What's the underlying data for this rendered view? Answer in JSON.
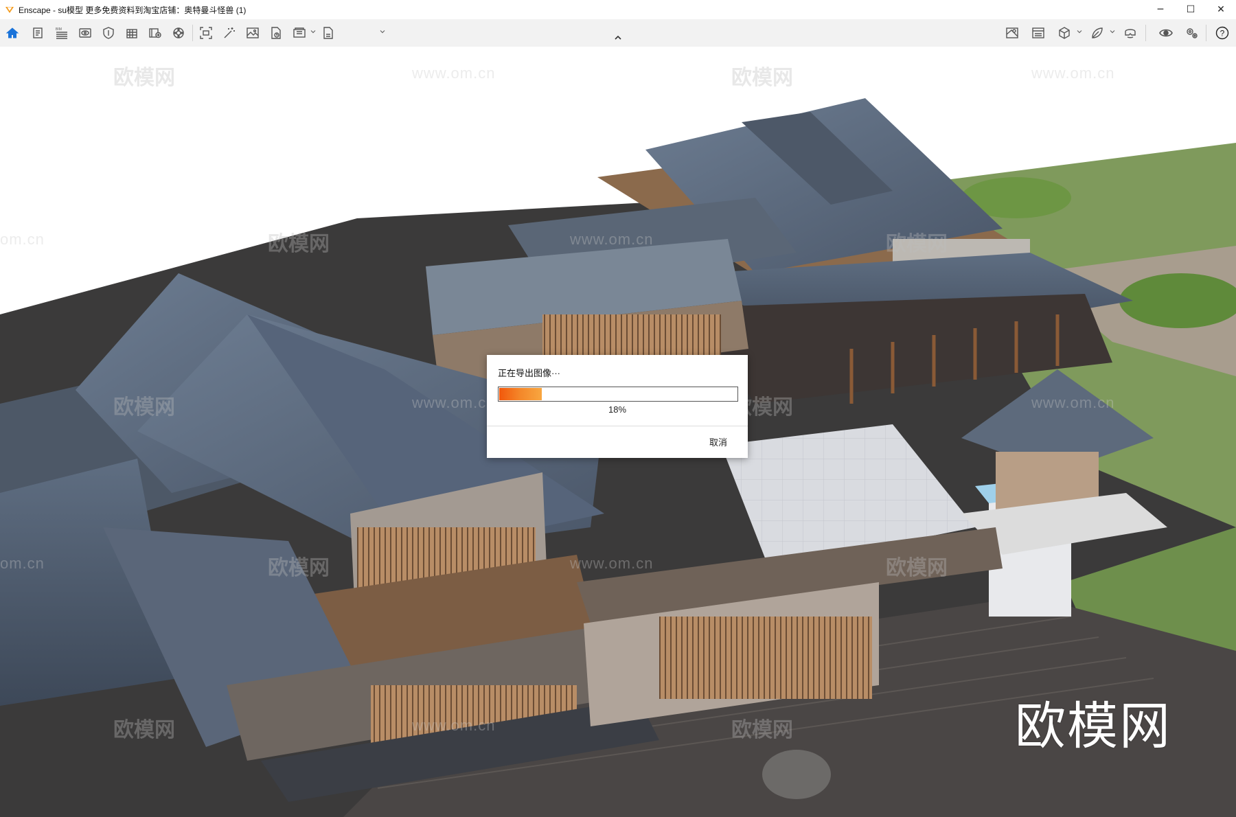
{
  "window": {
    "title": "Enscape - su模型  更多免费资料到淘宝店铺：奥特曼斗怪兽 (1)",
    "controls": {
      "minimize": "─",
      "maximize": "☐",
      "close": "✕"
    }
  },
  "toolbar": {
    "left_tools": [
      {
        "icon": "home-icon",
        "active": true
      },
      {
        "icon": "document-icon"
      },
      {
        "icon": "bim-icon",
        "label": "BIM"
      },
      {
        "icon": "view-icon"
      },
      {
        "icon": "shield-icon"
      },
      {
        "icon": "building-icon"
      },
      {
        "icon": "asset-icon"
      },
      {
        "icon": "material-icon"
      },
      {
        "icon": "screenshot-icon"
      },
      {
        "icon": "magic-wand-icon"
      },
      {
        "icon": "image-icon"
      },
      {
        "icon": "file-export-icon"
      },
      {
        "icon": "batch-render-icon"
      },
      {
        "icon": "exe-export-icon"
      }
    ],
    "right_tools": [
      {
        "icon": "map-icon"
      },
      {
        "icon": "gallery-icon"
      },
      {
        "icon": "cube-icon"
      },
      {
        "icon": "plant-icon"
      },
      {
        "icon": "vr-headset-icon"
      },
      {
        "icon": "eye-icon"
      },
      {
        "icon": "settings-icon"
      },
      {
        "icon": "help-icon",
        "label": "?"
      }
    ]
  },
  "watermarks": {
    "logo_text": "欧模网",
    "url_text": "www.om.cn",
    "edge_text": "om.cn",
    "brand": "欧模网"
  },
  "dialog": {
    "title": "正在导出图像···",
    "progress": 0.18,
    "percent_label": "18%",
    "cancel_label": "取消",
    "accent": "#f4782a"
  }
}
